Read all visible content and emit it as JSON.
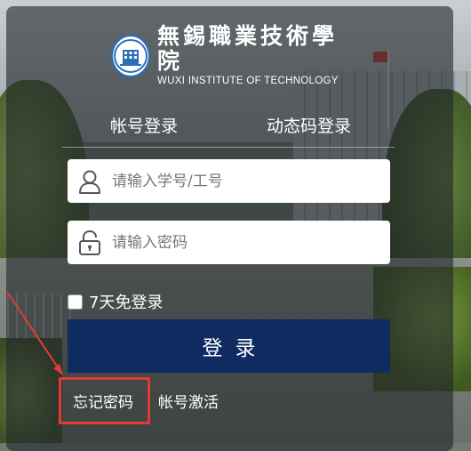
{
  "logo": {
    "name_cn": "無錫職業技術學院",
    "name_en": "WUXI INSTITUTE OF TECHNOLOGY",
    "icon": "school-emblem-icon"
  },
  "tabs": [
    {
      "label": "帐号登录"
    },
    {
      "label": "动态码登录"
    }
  ],
  "form": {
    "username": {
      "placeholder": "请输入学号/工号",
      "value": "",
      "icon": "user-icon"
    },
    "password": {
      "placeholder": "请输入密码",
      "value": "",
      "icon": "lock-icon"
    },
    "remember_label": "7天免登录",
    "remember_checked": false,
    "submit_label": "登录"
  },
  "links": {
    "forgot_password": "忘记密码",
    "activate_account": "帐号激活"
  },
  "colors": {
    "submit_button": "#0f2b60",
    "highlight": "#e23b35",
    "panel_overlay": "rgba(36,40,44,0.62)"
  }
}
